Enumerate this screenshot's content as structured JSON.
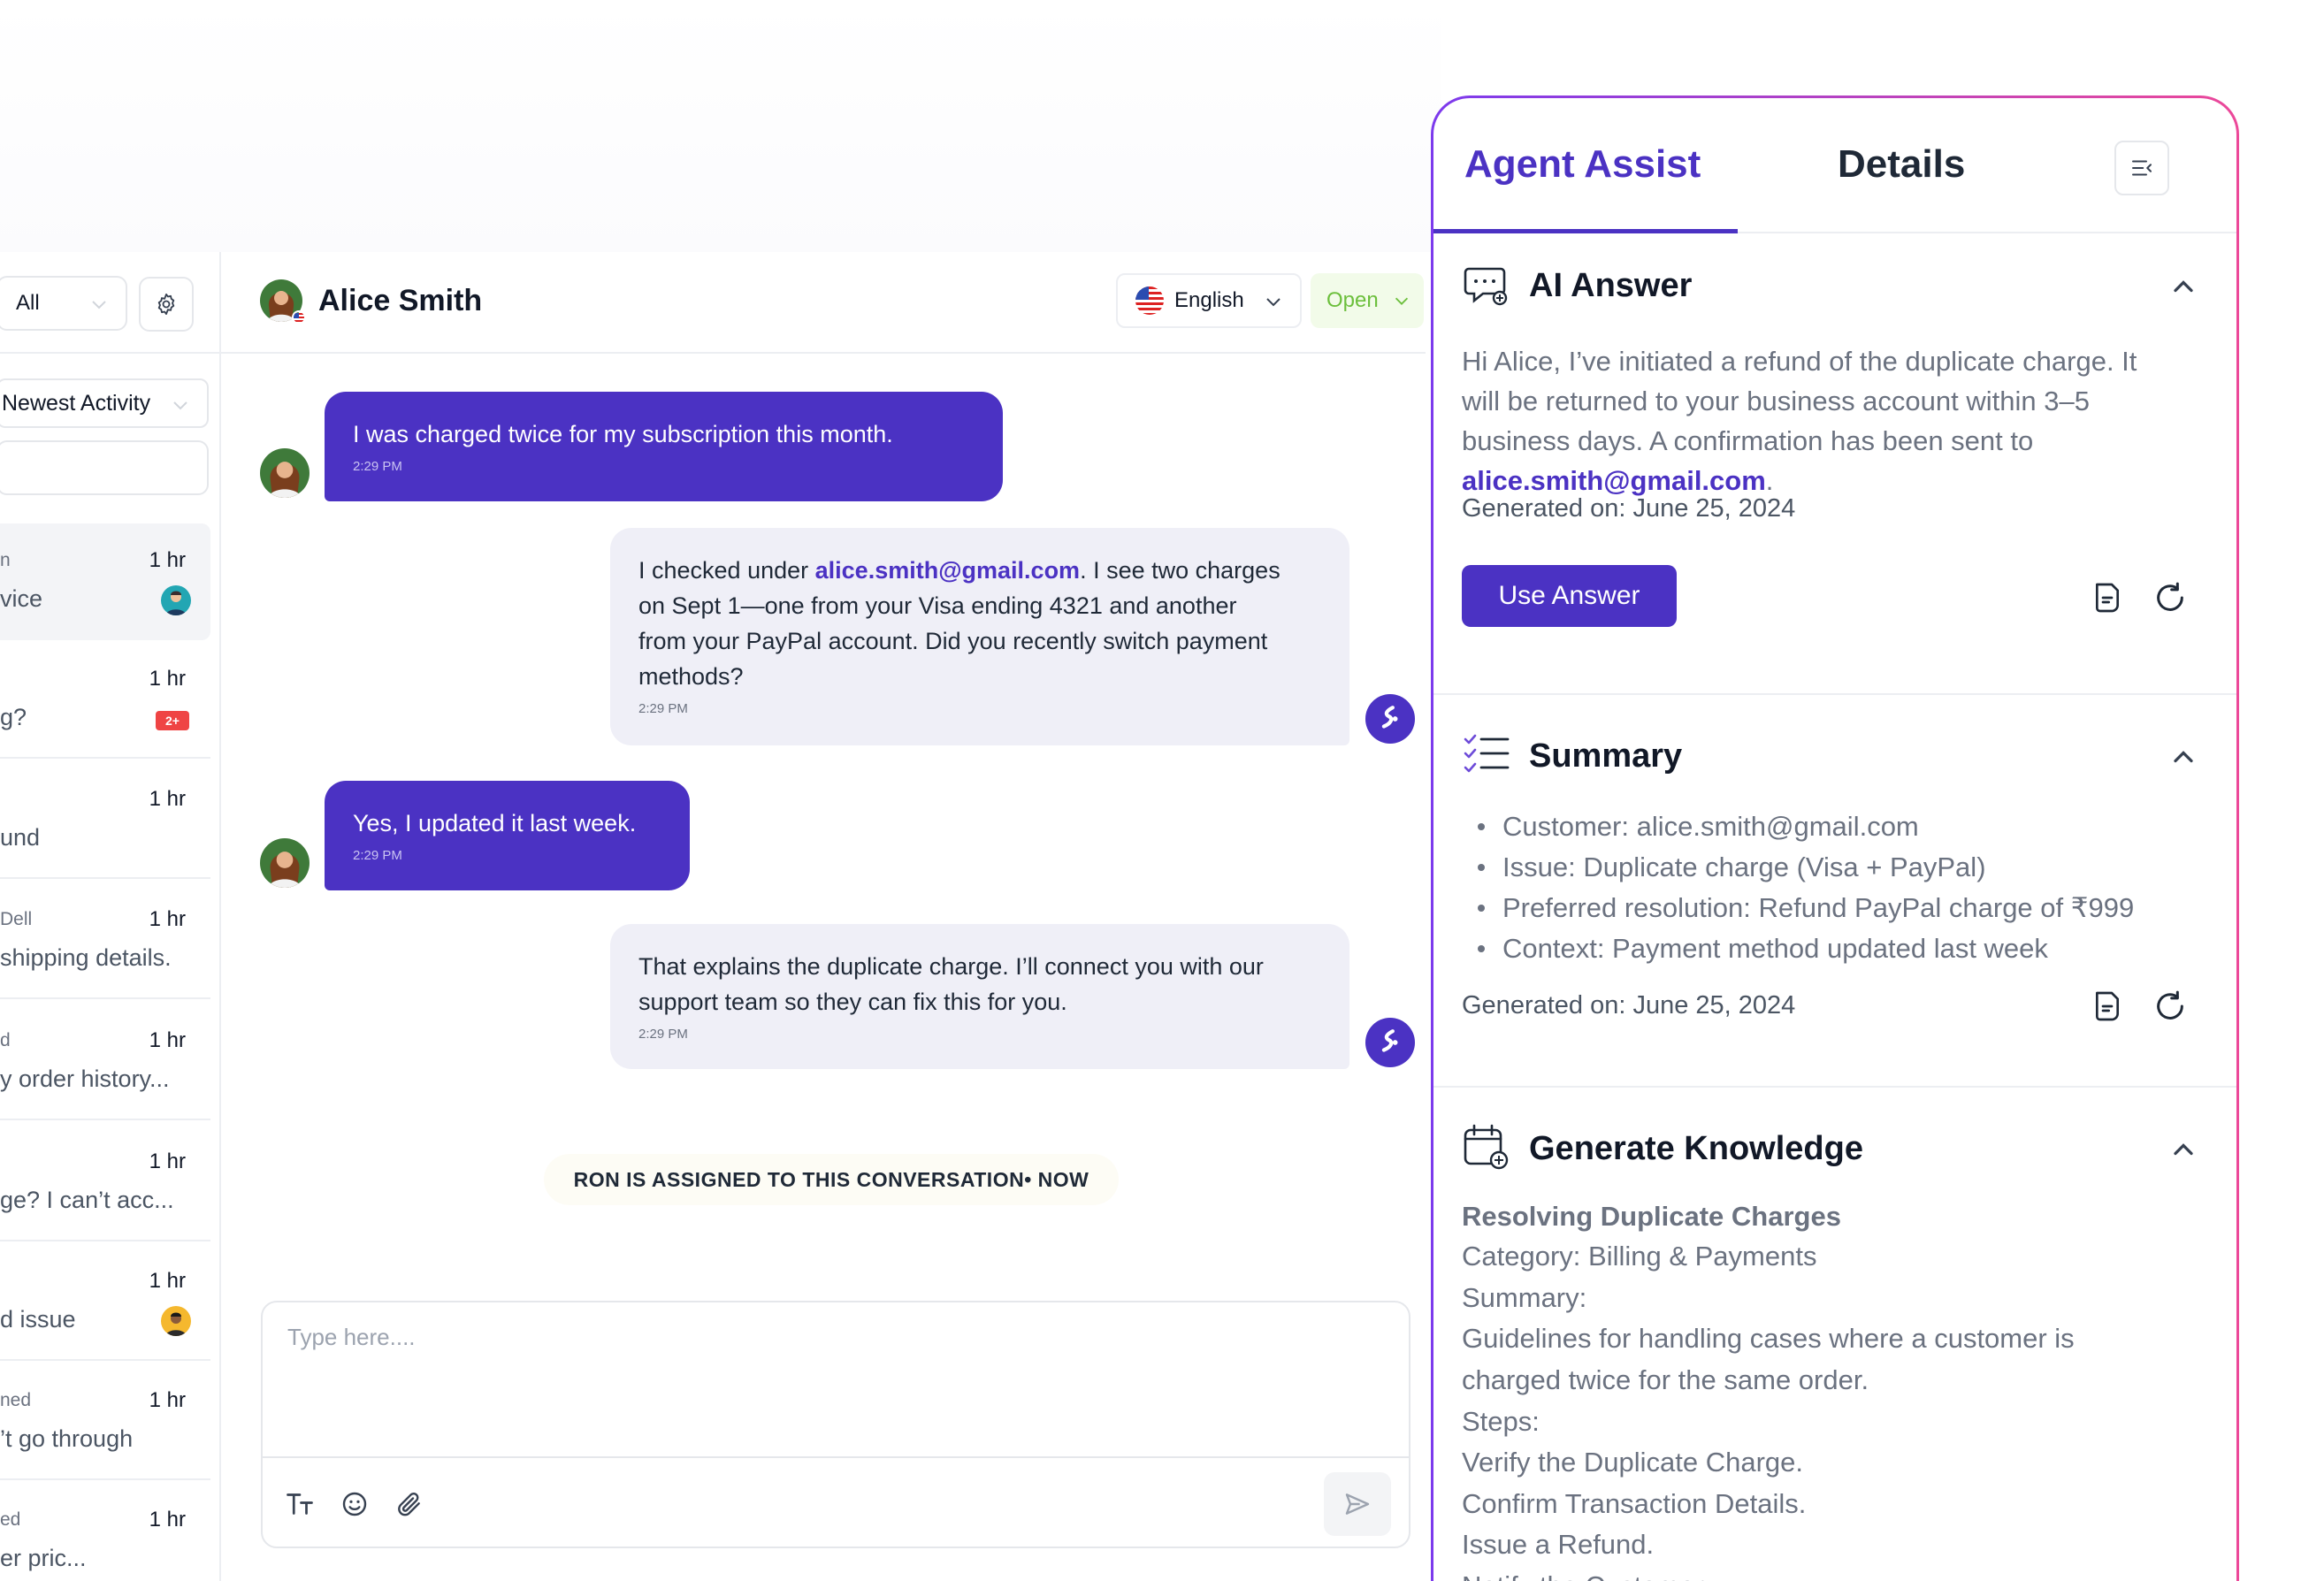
{
  "list": {
    "filter_value": "All",
    "sort_value": "Newest Activity",
    "conversations": [
      {
        "name": "n",
        "time": "1 hr",
        "message": "vice"
      },
      {
        "name": "",
        "time": "1 hr",
        "message": "g?",
        "badge": "2+"
      },
      {
        "name": "",
        "time": "1 hr",
        "message": "und"
      },
      {
        "name": "Dell",
        "time": "1 hr",
        "message": "shipping details."
      },
      {
        "name": "d",
        "time": "1 hr",
        "message": "y order history..."
      },
      {
        "name": "",
        "time": "1 hr",
        "message": "ge? I can’t acc..."
      },
      {
        "name": "",
        "time": "1 hr",
        "message": "d issue"
      },
      {
        "name": "ned",
        "time": "1 hr",
        "message": "’t go through"
      },
      {
        "name": "ed",
        "time": "1 hr",
        "message": "er pric..."
      }
    ]
  },
  "chat": {
    "contact_name": "Alice Smith",
    "language": "English",
    "status": "Open",
    "messages": [
      {
        "text": "I was charged twice for my subscription this month.",
        "time": "2:29 PM"
      },
      {
        "pre": "I checked under ",
        "email": "alice.smith@gmail.com",
        "line1_rest": ". I see two charges",
        "lines": [
          "on Sept 1—one from your Visa ending 4321 and another",
          "from your PayPal account. Did you recently switch payment",
          "methods?"
        ],
        "time": "2:29 PM"
      },
      {
        "text": "Yes, I updated it last week.",
        "time": "2:29 PM"
      },
      {
        "lines": [
          "That explains the duplicate charge. I’ll connect you with our",
          "support team so they can fix this for you."
        ],
        "time": "2:29 PM"
      }
    ],
    "system_notice": "RON IS ASSIGNED TO THIS CONVERSATION• NOW",
    "composer_placeholder": "Type here...."
  },
  "assist": {
    "tab_agent": "Agent Assist",
    "tab_details": "Details",
    "ai_answer": {
      "title": "AI Answer",
      "lines": [
        "Hi Alice, I’ve initiated a refund of the duplicate charge. It",
        "will be returned to your business account within 3–5",
        "business days. A confirmation has been sent to"
      ],
      "email": "alice.smith@gmail.com",
      "email_suffix": ".",
      "generated": "Generated on: June 25, 2024",
      "use_label": "Use Answer"
    },
    "summary": {
      "title": "Summary",
      "items": [
        "Customer: alice.smith@gmail.com",
        "Issue: Duplicate charge (Visa + PayPal)",
        "Preferred resolution: Refund PayPal charge of ₹999",
        "Context: Payment method updated last week"
      ],
      "generated": "Generated on: June 25, 2024"
    },
    "knowledge": {
      "title": "Generate Knowledge",
      "heading": "Resolving Duplicate Charges",
      "category": "Category: Billing & Payments",
      "summary_label": "Summary:",
      "summary_lines": [
        "Guidelines for handling cases where a customer is",
        "charged twice for the same order."
      ],
      "steps_label": "Steps:",
      "steps": [
        "Verify the Duplicate Charge.",
        "Confirm Transaction Details.",
        "Issue a Refund.",
        "Notify the Customer"
      ]
    }
  },
  "colors": {
    "brand": "#4b32c3",
    "status_open": "#6cbf3c",
    "badge": "#ef4444"
  }
}
